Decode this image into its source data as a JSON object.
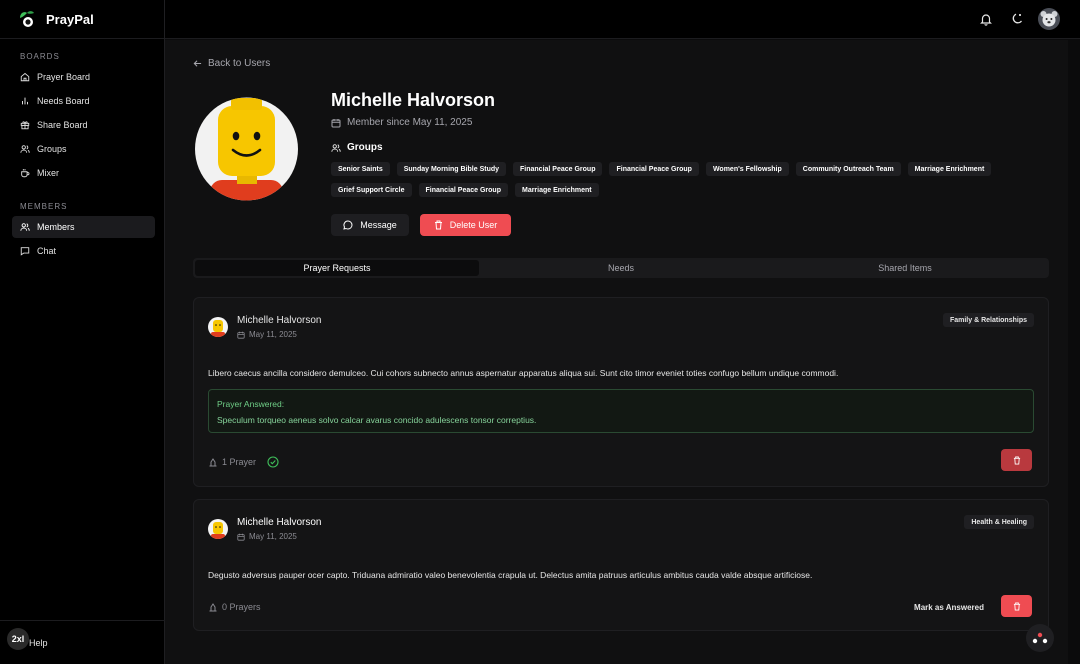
{
  "app": {
    "name": "PrayPal"
  },
  "sidebar": {
    "boards_label": "BOARDS",
    "boards": [
      {
        "label": "Prayer Board",
        "icon": "home-icon"
      },
      {
        "label": "Needs Board",
        "icon": "bar-chart-icon"
      },
      {
        "label": "Share Board",
        "icon": "gift-icon"
      },
      {
        "label": "Groups",
        "icon": "users-icon"
      },
      {
        "label": "Mixer",
        "icon": "coffee-icon"
      }
    ],
    "members_label": "MEMBERS",
    "members": [
      {
        "label": "Members",
        "icon": "users-icon",
        "active": true
      },
      {
        "label": "Chat",
        "icon": "chat-icon"
      }
    ],
    "help_label": "Help",
    "zoom_badge": "2xl"
  },
  "profile": {
    "back_label": "Back to Users",
    "name": "Michelle Halvorson",
    "member_since": "Member since May 11, 2025",
    "groups_heading": "Groups",
    "groups": [
      "Senior Saints",
      "Sunday Morning Bible Study",
      "Financial Peace Group",
      "Financial Peace Group",
      "Women's Fellowship",
      "Community Outreach Team",
      "Marriage Enrichment",
      "Grief Support Circle",
      "Financial Peace Group",
      "Marriage Enrichment"
    ],
    "message_label": "Message",
    "delete_label": "Delete User"
  },
  "tabs": [
    {
      "label": "Prayer Requests",
      "active": true
    },
    {
      "label": "Needs"
    },
    {
      "label": "Shared Items"
    }
  ],
  "requests": [
    {
      "author": "Michelle Halvorson",
      "date": "May 11, 2025",
      "category": "Family & Relationships",
      "body": "Libero caecus ancilla considero demulceo. Cui cohors subnecto annus aspernatur apparatus aliqua sui. Sunt cito timor eveniet toties confugo bellum undique commodi.",
      "answered_heading": "Prayer Answered:",
      "answered_text": "Speculum torqueo aeneus solvo calcar avarus concido adulescens tonsor correptius.",
      "prayers": "1 Prayer"
    },
    {
      "author": "Michelle Halvorson",
      "date": "May 11, 2025",
      "category": "Health & Healing",
      "body": "Degusto adversus pauper ocer capto. Triduana admiratio valeo benevolentia crapula ut. Delectus amita patruus articulus ambitus cauda valde absque artificiose.",
      "prayers": "0 Prayers",
      "mark_label": "Mark as Answered"
    }
  ]
}
